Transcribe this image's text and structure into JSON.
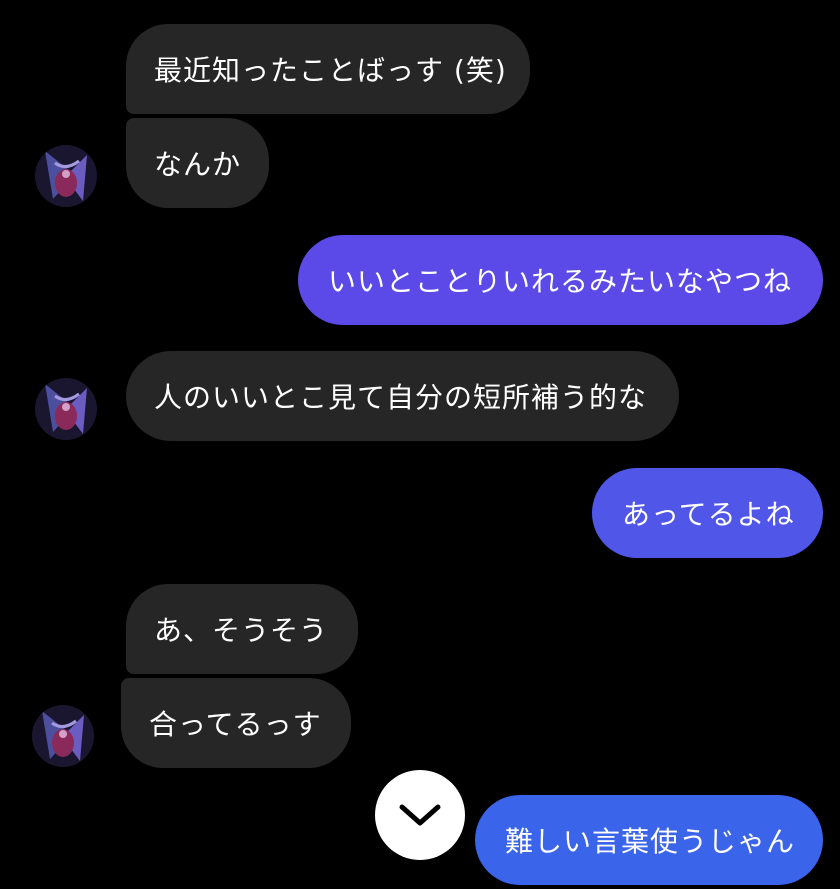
{
  "messages": [
    {
      "side": "in",
      "text": "最近知ったことばっす (笑)"
    },
    {
      "side": "in",
      "text": "なんか"
    },
    {
      "side": "out",
      "text": "いいとことりいれるみたいなやつね"
    },
    {
      "side": "in",
      "text": "人のいいとこ見て自分の短所補う的な"
    },
    {
      "side": "out",
      "text": "あってるよね"
    },
    {
      "side": "in",
      "text": "あ、そうそう"
    },
    {
      "side": "in",
      "text": "合ってるっす"
    },
    {
      "side": "out",
      "text": "難しい言葉使うじゃん"
    }
  ],
  "colors": {
    "background": "#000000",
    "incoming_bubble": "#262626",
    "outgoing_top": "#5b4ae8",
    "outgoing_mid": "#4f56e8",
    "outgoing_bottom": "#3a64ea",
    "text": "#ffffff"
  },
  "icons": {
    "avatar": "profile-avatar-icon",
    "scroll_down": "chevron-down-icon"
  }
}
